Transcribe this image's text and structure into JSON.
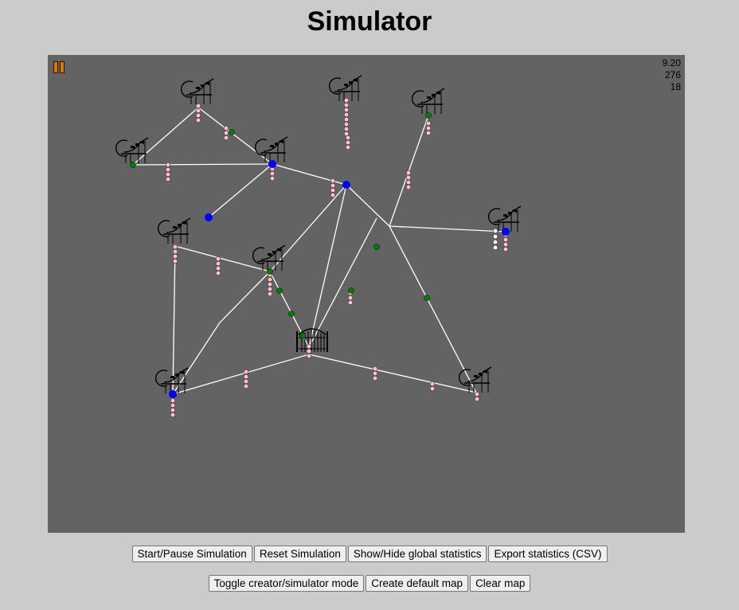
{
  "title": "Simulator",
  "stats": [
    "9.20",
    "276",
    "18"
  ],
  "buttons_row1": [
    "Start/Pause Simulation",
    "Reset Simulation",
    "Show/Hide global statistics",
    "Export statistics (CSV)"
  ],
  "buttons_row2": [
    "Toggle creator/simulator mode",
    "Create default map",
    "Clear map"
  ],
  "colors": {
    "page_bg": "#cbcbcb",
    "canvas_bg": "#636363",
    "road": "#ffffff",
    "visitor_queue": "#ffc0cb",
    "waiting_visitor": "#ffffff",
    "junction_blue": "#0000ff",
    "junction_green": "#008000",
    "pause_icon": "#e07800"
  },
  "map": {
    "attractions": 10,
    "entrance_gates": 1,
    "attraction_icon": "roller-coaster-icon",
    "gate_icon": "park-gate-icon"
  }
}
